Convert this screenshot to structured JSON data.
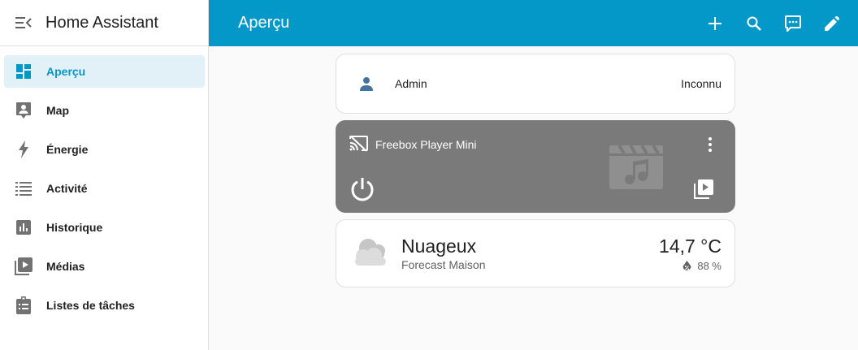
{
  "app": {
    "title": "Home Assistant"
  },
  "header": {
    "title": "Aperçu",
    "actions": [
      {
        "icon": "plus-icon"
      },
      {
        "icon": "search-icon"
      },
      {
        "icon": "assist-icon"
      },
      {
        "icon": "pencil-icon"
      }
    ]
  },
  "sidebar": {
    "items": [
      {
        "label": "Aperçu",
        "icon": "dashboard-icon",
        "active": true
      },
      {
        "label": "Map",
        "icon": "map-person-icon"
      },
      {
        "label": "Énergie",
        "icon": "lightning-icon"
      },
      {
        "label": "Activité",
        "icon": "list-icon"
      },
      {
        "label": "Historique",
        "icon": "chart-box-icon"
      },
      {
        "label": "Médias",
        "icon": "play-box-icon"
      },
      {
        "label": "Listes de tâches",
        "icon": "clipboard-list-icon"
      }
    ]
  },
  "cards": {
    "person": {
      "name": "Admin",
      "state": "Inconnu",
      "icon": "account-icon"
    },
    "media": {
      "name": "Freebox Player Mini",
      "icon": "cast-off-icon",
      "art_icon": "movie-music-icon",
      "power_icon": "power-icon",
      "browse_icon": "play-box-multiple-icon"
    },
    "weather": {
      "condition": "Nuageux",
      "name": "Forecast Maison",
      "temperature": "14,7 °C",
      "humidity": "88 %",
      "icon": "cloudy-icon"
    }
  },
  "colors": {
    "primary": "#0398c8",
    "active_bg": "#e1f1f7",
    "media_bg": "#7a7a7a",
    "icon_grey": "#727272"
  }
}
